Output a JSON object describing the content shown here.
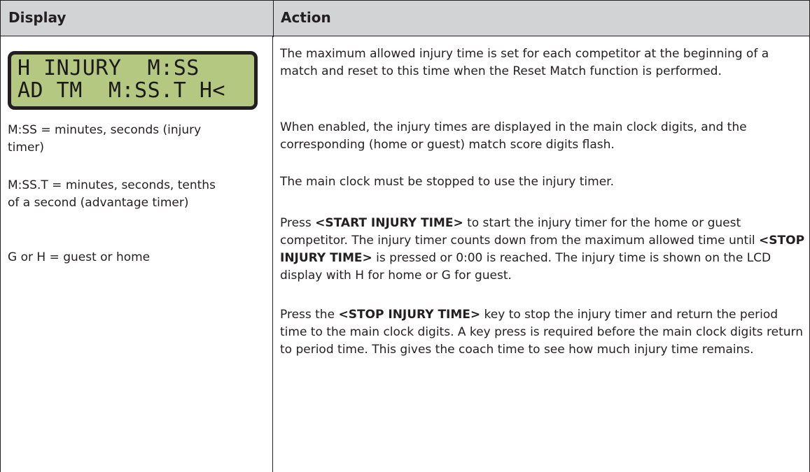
{
  "table": {
    "headers": {
      "display": "Display",
      "action": "Action"
    },
    "lcd": {
      "line1": "H INJURY  M:SS",
      "line2": "AD TM  M:SS.T H<"
    },
    "legend": [
      "M:SS = minutes, seconds (injury timer)",
      "M:SS.T = minutes, seconds, tenths of a second (advantage timer)",
      "G or H = guest or home"
    ],
    "actions": {
      "p1": "The maximum allowed injury time is set for each competitor at the beginning of a match and reset to this time when the Reset Match function is performed.",
      "p2": "When enabled, the injury times are displayed in the main clock digits, and the corresponding (home or guest) match score digits flash.",
      "p3": "The main clock must be stopped to use the injury timer.",
      "p4": {
        "t1": "Press ",
        "k1": "<START INJURY TIME>",
        "t2": " to start the injury timer for the home or guest competitor. The injury timer counts down from the maximum allowed time until ",
        "k2": "<STOP INJURY TIME>",
        "t3": " is pressed or 0:00 is reached. The injury time is shown on the LCD display with H for home or G for guest."
      },
      "p5": {
        "t1": "Press the ",
        "k1": "<STOP INJURY TIME>",
        "t2": " key to stop the injury timer and return the period time to the main clock digits. A key press is required before the main clock digits return to period time. This gives the coach time to see how much injury time remains."
      }
    }
  }
}
